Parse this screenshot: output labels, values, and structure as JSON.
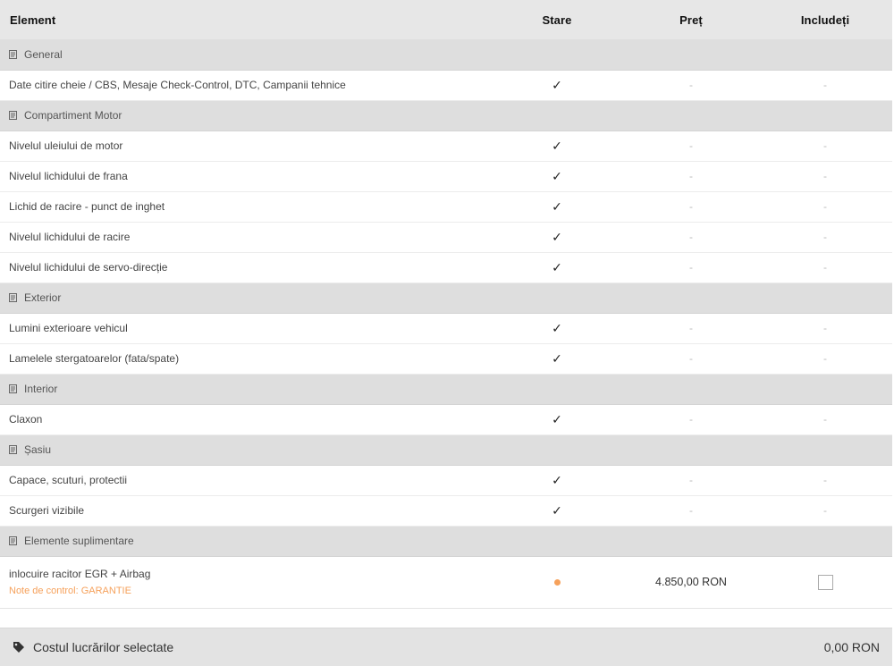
{
  "table": {
    "headers": {
      "element": "Element",
      "status": "Stare",
      "price": "Preț",
      "include": "Includeți"
    },
    "groups": [
      {
        "title": "General",
        "items": [
          {
            "name": "Date citire cheie / CBS, Mesaje Check-Control, DTC, Campanii tehnice",
            "status": "✓",
            "price": "-",
            "include": "-"
          }
        ]
      },
      {
        "title": "Compartiment Motor",
        "items": [
          {
            "name": "Nivelul uleiului de motor",
            "status": "✓",
            "price": "-",
            "include": "-"
          },
          {
            "name": "Nivelul lichidului de frana",
            "status": "✓",
            "price": "-",
            "include": "-"
          },
          {
            "name": "Lichid de racire - punct de inghet",
            "status": "✓",
            "price": "-",
            "include": "-"
          },
          {
            "name": "Nivelul lichidului de racire",
            "status": "✓",
            "price": "-",
            "include": "-"
          },
          {
            "name": "Nivelul lichidului de servo-direcție",
            "status": "✓",
            "price": "-",
            "include": "-"
          }
        ]
      },
      {
        "title": "Exterior",
        "items": [
          {
            "name": "Lumini exterioare vehicul",
            "status": "✓",
            "price": "-",
            "include": "-"
          },
          {
            "name": "Lamelele stergatoarelor (fata/spate)",
            "status": "✓",
            "price": "-",
            "include": "-"
          }
        ]
      },
      {
        "title": "Interior",
        "items": [
          {
            "name": "Claxon",
            "status": "✓",
            "price": "-",
            "include": "-"
          }
        ]
      },
      {
        "title": "Șasiu",
        "items": [
          {
            "name": "Capace, scuturi, protectii",
            "status": "✓",
            "price": "-",
            "include": "-"
          },
          {
            "name": "Scurgeri vizibile",
            "status": "✓",
            "price": "-",
            "include": "-"
          }
        ]
      },
      {
        "title": "Elemente suplimentare",
        "items": [
          {
            "name": "inlocuire racitor EGR + Airbag",
            "note": "Note de control: GARANTIE",
            "status_color": "#f6a15b",
            "price": "4.850,00 RON",
            "include_checked": false
          }
        ]
      }
    ]
  },
  "footer": {
    "label": "Costul lucrărilor selectate",
    "total": "0,00 RON",
    "icon": "tag-icon"
  },
  "colors": {
    "header_bg": "#e7e7e7",
    "group_bg": "#dedede",
    "accent_orange": "#f6a15b",
    "footer_bg": "#e3e3e3"
  }
}
